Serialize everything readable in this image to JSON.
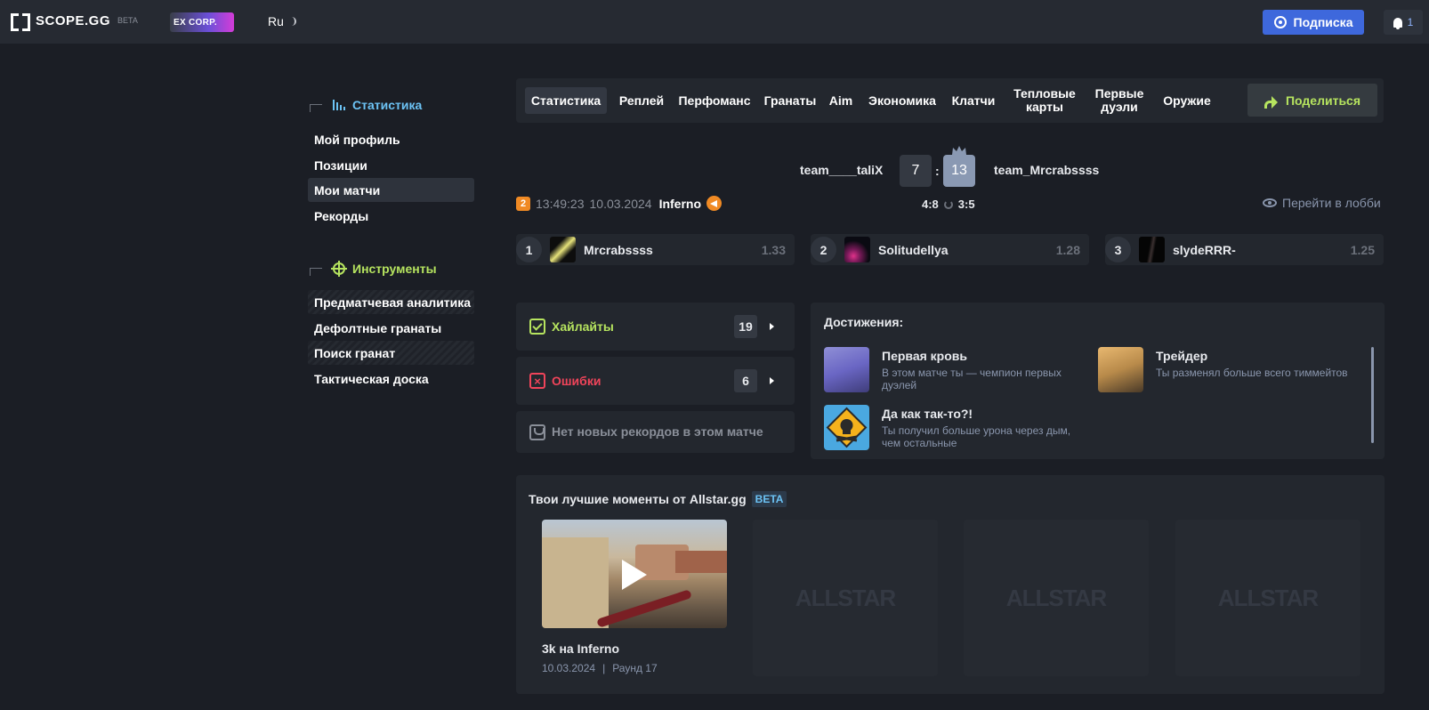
{
  "header": {
    "logo_text": "SCOPE.GG",
    "logo_beta": "BETA",
    "partner": "EX CORP.",
    "lang": "Ru",
    "subscribe_label": "Подписка",
    "notifications_count": "1"
  },
  "sidebar": {
    "stats_heading": "Статистика",
    "stats_items": [
      {
        "label": "Мой профиль"
      },
      {
        "label": "Позиции"
      },
      {
        "label": "Мои матчи",
        "active": true
      },
      {
        "label": "Рекорды"
      }
    ],
    "tools_heading": "Инструменты",
    "tools_items": [
      {
        "label": "Предматчевая аналитика"
      },
      {
        "label": "Дефолтные гранаты"
      },
      {
        "label": "Поиск гранат"
      },
      {
        "label": "Тактическая доска"
      }
    ]
  },
  "tabs": {
    "items": [
      {
        "label": "Статистика",
        "active": true
      },
      {
        "label": "Реплей"
      },
      {
        "label": "Перфоманс"
      },
      {
        "label": "Гранаты"
      },
      {
        "label": "Aim"
      },
      {
        "label": "Экономика"
      },
      {
        "label": "Клатчи"
      },
      {
        "label": "Тепловые карты"
      },
      {
        "label": "Первые дуэли"
      },
      {
        "label": "Оружие"
      }
    ],
    "share_label": "Поделиться"
  },
  "match": {
    "team_left": "team____taliX",
    "team_right": "team_Mrcrabssss",
    "score_left": "7",
    "score_colon": ":",
    "score_right": "13",
    "half_left": "4:8",
    "half_right": "3:5",
    "time": "13:49:23",
    "date": "10.03.2024",
    "map": "Inferno",
    "source_badge": "2",
    "lobby_label": "Перейти в лобби"
  },
  "top_players": [
    {
      "rank": "1",
      "name": "Mrcrabssss",
      "rating": "1.33"
    },
    {
      "rank": "2",
      "name": "Solitudellya",
      "rating": "1.28"
    },
    {
      "rank": "3",
      "name": "slydeRRR-",
      "rating": "1.25"
    }
  ],
  "highlights": {
    "highlights_label": "Хайлайты",
    "highlights_count": "19",
    "errors_label": "Ошибки",
    "errors_count": "6",
    "records_text": "Нет новых рекордов в этом матче"
  },
  "achievements": {
    "title": "Достижения:",
    "items": [
      {
        "name": "Первая кровь",
        "desc": "В этом матче ты — чемпион первых дуэлей"
      },
      {
        "name": "Трейдер",
        "desc": "Ты разменял больше всего тиммейтов"
      },
      {
        "name": "Да как так-то?!",
        "desc": "Ты получил больше урона через дым, чем остальные"
      }
    ]
  },
  "allstar": {
    "title": "Твои лучшие моменты от Allstar.gg",
    "beta": "BETA",
    "clip_title": "3k на Inferno",
    "clip_date": "10.03.2024",
    "clip_sep": "|",
    "clip_round": "Раунд 17",
    "placeholder_text": "ALLSTAR"
  },
  "colors": {
    "accent_blue": "#3e68dc",
    "stats_blue": "#6cc3f5",
    "tools_green": "#b6e45f",
    "error_red": "#f0445a",
    "map_orange": "#f08a24"
  }
}
